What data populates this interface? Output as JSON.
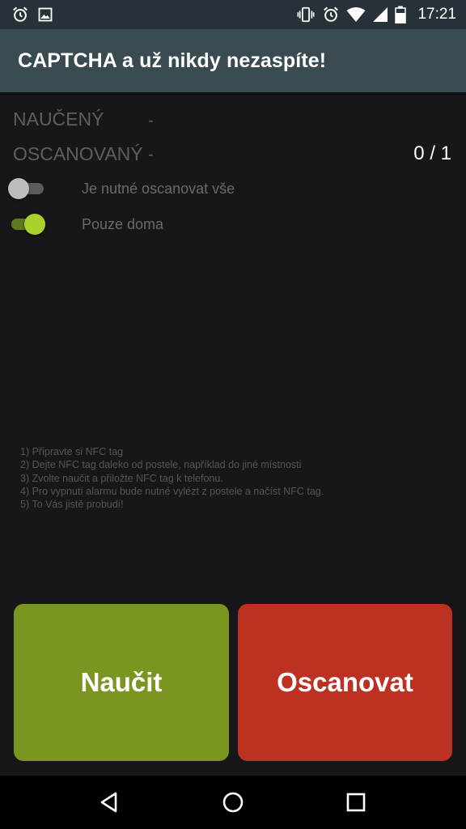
{
  "status_bar": {
    "time": "17:21",
    "left_icons": [
      "alarm-icon",
      "image-icon"
    ],
    "right_icons": [
      "vibrate-icon",
      "alarm-icon",
      "wifi-icon",
      "signal-icon",
      "battery-icon"
    ]
  },
  "app_bar": {
    "title": "CAPTCHA a už nikdy nezaspíte!"
  },
  "learned": {
    "label": "NAUČENÝ",
    "value": "-"
  },
  "scanned": {
    "label": "OSCANOVANÝ",
    "value": "-",
    "counter": "0 / 1"
  },
  "switches": [
    {
      "label": "Je nutné oscanovat vše",
      "on": false
    },
    {
      "label": "Pouze doma",
      "on": true
    }
  ],
  "instructions": [
    "1) Připravte si NFC tag",
    "2) Dejte NFC tag daleko od postele, například do jiné místnosti",
    "3) Zvolte naučit a přiložte NFC tag k telefonu.",
    "4) Pro vypnutí alarmu bude nutné vylézt z postele a načíst NFC tag.",
    "5) To Vás jistě probudí!"
  ],
  "buttons": {
    "learn_label": "Naučit",
    "scan_label": "Oscanovat"
  },
  "colors": {
    "status_bar": "#263238",
    "app_bar": "#3a4a51",
    "background": "#171719",
    "learn_button": "#7a9621",
    "scan_button": "#bc3122",
    "switch_accent": "#a8d22b"
  },
  "nav_bar": {
    "icons": [
      "back-icon",
      "home-icon",
      "recents-icon"
    ]
  }
}
